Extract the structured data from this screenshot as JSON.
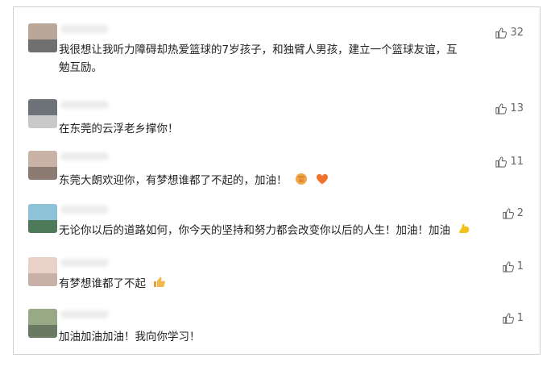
{
  "comments": [
    {
      "text_lines": [
        "我很想让我听力障碍却热爱篮球的7岁孩子，和独臂人男孩，建立一个篮球友谊，互",
        "勉互励。"
      ],
      "likes": "32",
      "avatar_colors": [
        "#b9a79a",
        "#6f6f6f"
      ]
    },
    {
      "text_lines": [
        "在东莞的云浮老乡撑你！"
      ],
      "likes": "13",
      "avatar_colors": [
        "#6d7278",
        "#c9c9c9"
      ]
    },
    {
      "text_lines": [
        "东莞大朗欢迎你，有梦想谁都了不起的，加油！"
      ],
      "likes": "11",
      "emojis": [
        "fist-icon",
        "heart-icon"
      ],
      "avatar_colors": [
        "#c8b3a6",
        "#8b7b73"
      ]
    },
    {
      "text_lines": [
        "无论你以后的道路如何，你今天的坚持和努力都会改变你以后的人生！加油！加油"
      ],
      "likes": "2",
      "emojis": [
        "flexed-biceps-icon"
      ],
      "avatar_colors": [
        "#8ec2d8",
        "#4f7a5a"
      ]
    },
    {
      "text_lines": [
        "有梦想谁都了不起"
      ],
      "likes": "1",
      "emojis": [
        "thumbs-up-icon"
      ],
      "avatar_colors": [
        "#e8d1c8",
        "#c7b0a8"
      ]
    },
    {
      "text_lines": [
        "加油加油加油！我向你学习！"
      ],
      "likes": "1",
      "avatar_colors": [
        "#98a985",
        "#6a7a62"
      ]
    }
  ]
}
